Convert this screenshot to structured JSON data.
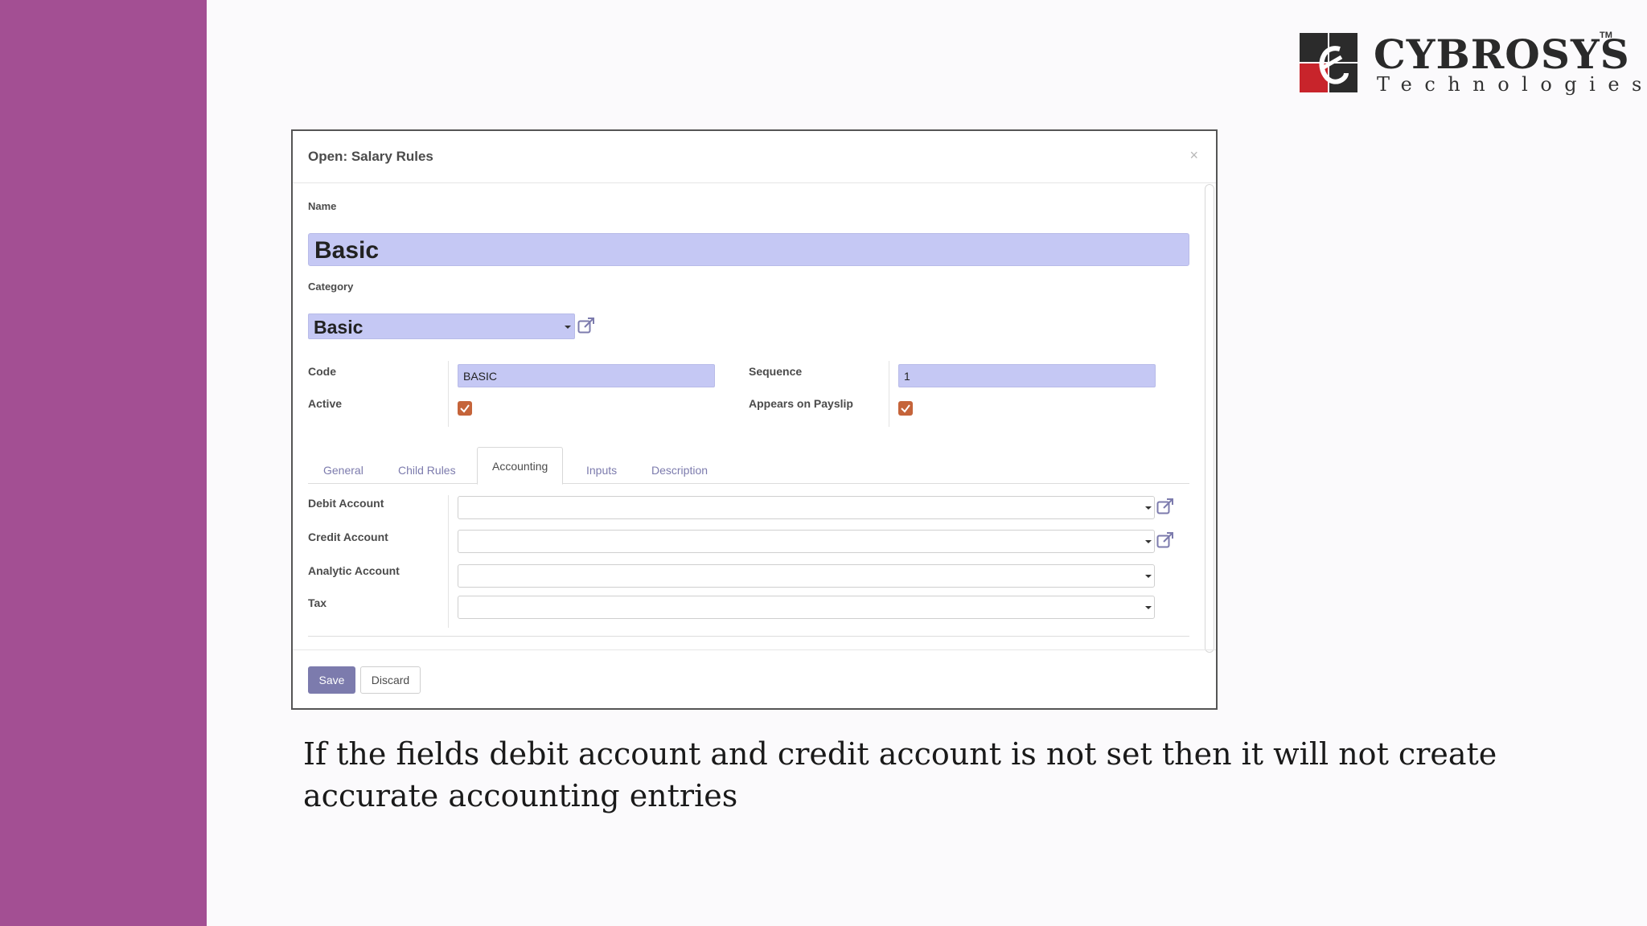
{
  "brand": {
    "name": "CYBROSYS",
    "tm": "TM",
    "subtitle": "Technologies"
  },
  "dialog": {
    "title": "Open: Salary Rules",
    "close_glyph": "×",
    "fields": {
      "name_label": "Name",
      "name_value": "Basic",
      "category_label": "Category",
      "category_value": "Basic",
      "code_label": "Code",
      "code_value": "BASIC",
      "active_label": "Active",
      "active_checked": true,
      "sequence_label": "Sequence",
      "sequence_value": "1",
      "appears_label": "Appears on Payslip",
      "appears_checked": true
    },
    "tabs": [
      {
        "label": "General"
      },
      {
        "label": "Child Rules"
      },
      {
        "label": "Accounting",
        "active": true
      },
      {
        "label": "Inputs"
      },
      {
        "label": "Description"
      }
    ],
    "accounting": {
      "debit_label": "Debit Account",
      "credit_label": "Credit Account",
      "analytic_label": "Analytic Account",
      "tax_label": "Tax",
      "debit_value": "",
      "credit_value": "",
      "analytic_value": "",
      "tax_value": ""
    },
    "buttons": {
      "save": "Save",
      "discard": "Discard"
    }
  },
  "caption": "If the fields debit account and credit account is not set then it will not create accurate accounting entries",
  "colors": {
    "left_band": "#a34f93",
    "input_highlight": "#c5c8f4",
    "primary_button": "#7c7bad",
    "checkbox": "#c5643a"
  }
}
